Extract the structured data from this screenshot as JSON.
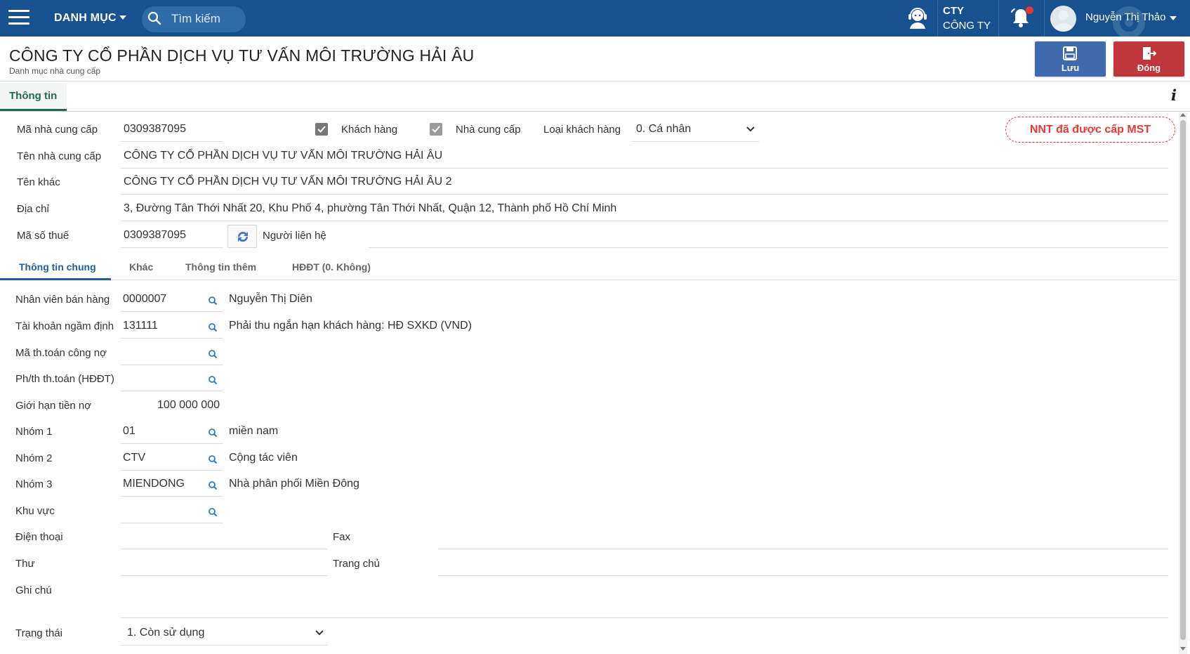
{
  "topbar": {
    "menu_label": "DANH MỤC",
    "search_placeholder": "Tìm kiếm",
    "company_code": "CTY",
    "company_name": "CÔNG TY",
    "user_name": "Nguyễn Thị Thảo",
    "accent": "#17518f"
  },
  "header": {
    "title": "CÔNG TY CỔ PHẦN DỊCH VỤ TƯ VẤN MÔI TRƯỜNG HẢI ÂU",
    "subtitle": "Danh mục nhà cung cấp",
    "save_label": "Lưu",
    "close_label": "Đóng",
    "save_color": "#3f6aae",
    "close_color": "#c0363a"
  },
  "main_tab": "Thông tin",
  "form": {
    "supplier_code_label": "Mã nhà cung cấp",
    "supplier_code": "0309387095",
    "customer_label": "Khách hàng",
    "customer_checked": true,
    "supplier_label": "Nhà cung cấp",
    "supplier_checked": true,
    "customer_type_label": "Loại khách hàng",
    "customer_type": "0. Cá nhân",
    "mst_badge": "NNT đã được cấp MST",
    "supplier_name_label": "Tên nhà cung cấp",
    "supplier_name": "CÔNG TY CỔ PHẦN DỊCH VỤ TƯ VẤN MÔI TRƯỜNG HẢI ÂU",
    "other_name_label": "Tên khác",
    "other_name": "CÔNG TY CỔ PHẦN DỊCH VỤ TƯ VẤN MÔI TRƯỜNG HẢI ÂU 2",
    "address_label": "Địa chỉ",
    "address": "3, Đường Tân Thới Nhất 20,  Khu Phố 4, phường Tân Thới Nhất, Quận 12, Thành phố Hồ Chí Minh",
    "tax_code_label": "Mã số thuế",
    "tax_code": "0309387095",
    "contact_label": "Người liên hệ",
    "contact": ""
  },
  "subtabs": [
    "Thông tin chung",
    "Khác",
    "Thông tin thêm",
    "HĐĐT (0. Không)"
  ],
  "general": {
    "sales_staff_label": "Nhân viên bán hàng",
    "sales_staff_code": "0000007",
    "sales_staff_name": "Nguyễn Thị Diên",
    "default_account_label": "Tài khoản ngầm định",
    "default_account_code": "131111",
    "default_account_name": "Phải thu ngắn hạn khách hàng: HĐ SXKD (VND)",
    "payment_code_label": "Mã th.toán công nợ",
    "payment_code": "",
    "payment_method_label": "Ph/th th.toán (HĐĐT)",
    "payment_method": "",
    "credit_limit_label": "Giới hạn tiền nợ",
    "credit_limit": "100 000 000",
    "group1_label": "Nhóm 1",
    "group1_code": "01",
    "group1_name": "miền nam",
    "group2_label": "Nhóm 2",
    "group2_code": "CTV",
    "group2_name": "Cộng tác viên",
    "group3_label": "Nhóm 3",
    "group3_code": "MIENDONG",
    "group3_name": "Nhà phân phối Miền Đông",
    "region_label": "Khu vực",
    "region": "",
    "phone_label": "Điện thoại",
    "phone": "",
    "fax_label": "Fax",
    "fax": "",
    "email_label": "Thư",
    "email": "",
    "homepage_label": "Trang chủ",
    "homepage": "",
    "note_label": "Ghi chú",
    "note": "",
    "status_label": "Trạng thái",
    "status": "1. Còn sử dụng"
  }
}
